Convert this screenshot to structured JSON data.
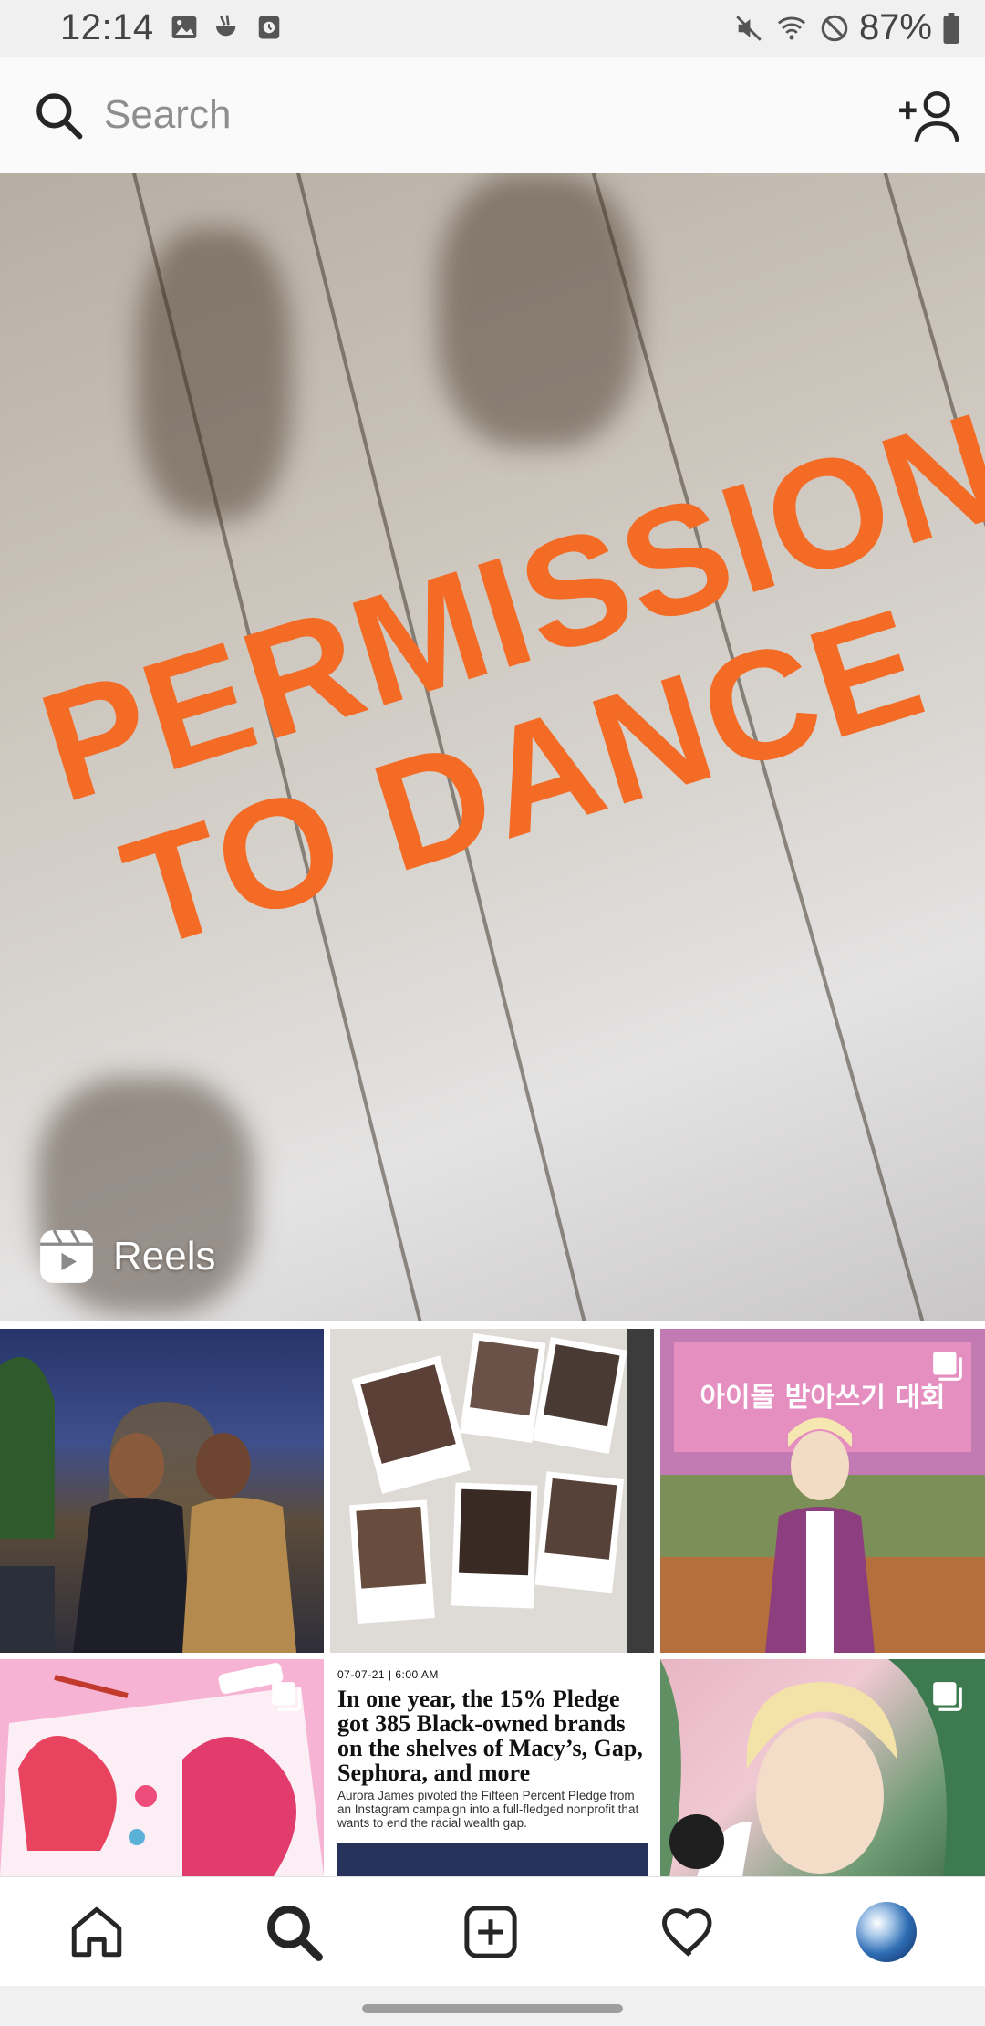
{
  "status_bar": {
    "time": "12:14",
    "battery": "87%",
    "left_icons": [
      "gallery-icon",
      "cup-icon",
      "clock-app-icon"
    ],
    "right_icons": [
      "mute-icon",
      "wifi-icon",
      "dnd-icon",
      "battery-icon"
    ]
  },
  "search": {
    "placeholder": "Search"
  },
  "hero": {
    "overlay_line1": "PERMISSION",
    "overlay_line2": "TO DANCE",
    "overlay_color": "#f36b25",
    "badge_label": "Reels"
  },
  "grid": {
    "article": {
      "date": "07-07-21 | 6:00 AM",
      "headline": "In one year, the 15% Pledge got 385 Black-owned brands on the shelves of Macy’s, Gap, Sephora, and more",
      "subtext": "Aurora James pivoted the Fifteen Percent Pledge from an Instagram campaign into a full-fledged nonprofit that wants to end the racial wealth gap."
    },
    "tile3_sign": "아이돌 받아쓰기 대회"
  },
  "bottom_nav": {
    "items": [
      "home-icon",
      "search-icon",
      "create-icon",
      "heart-icon",
      "profile-avatar"
    ]
  }
}
